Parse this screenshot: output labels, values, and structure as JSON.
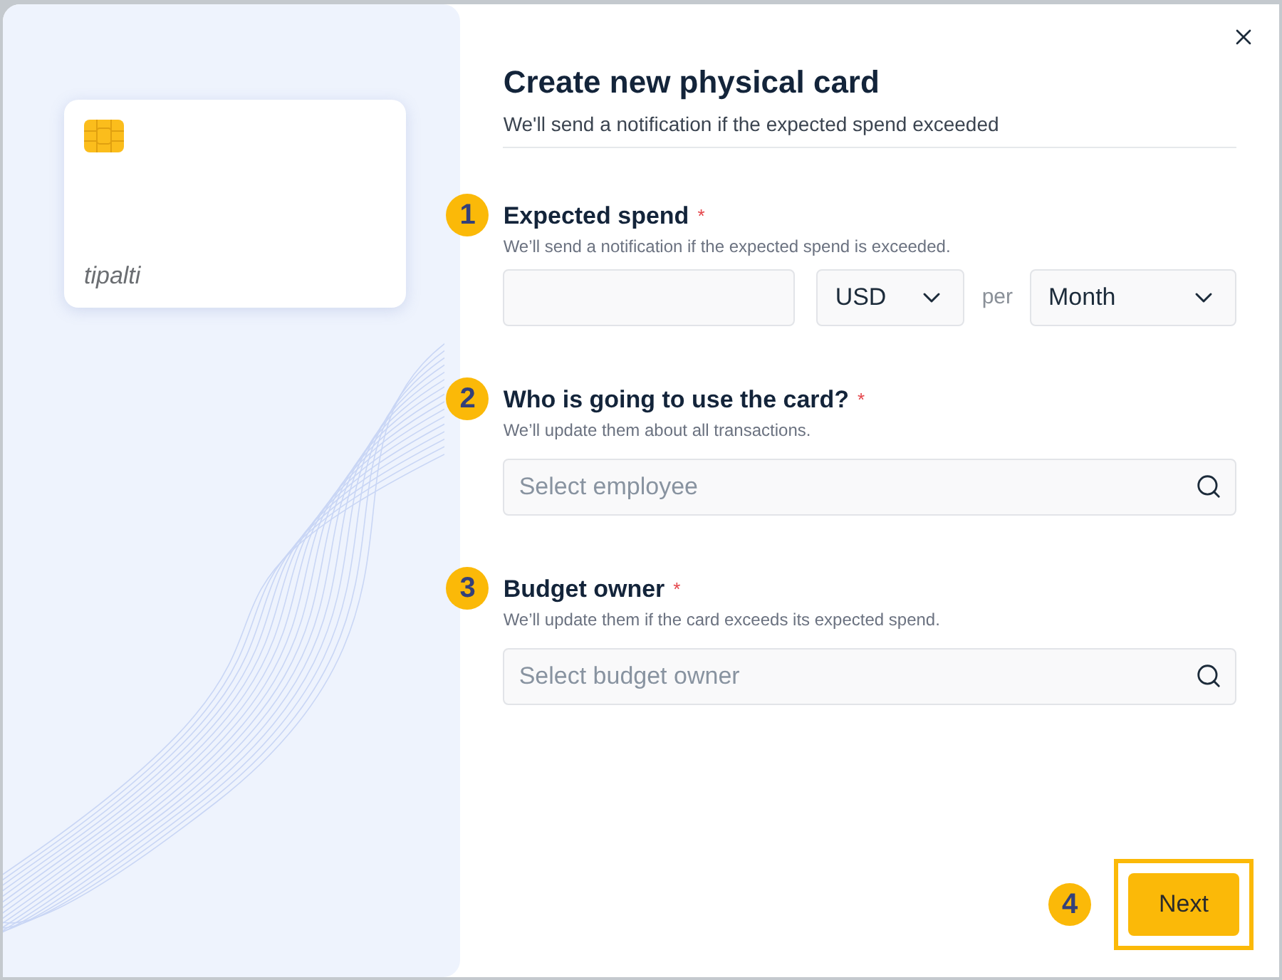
{
  "card_preview": {
    "logo": "tipalti"
  },
  "dialog": {
    "title": "Create new physical card",
    "subtitle": "We'll send a notification if the expected spend exceeded"
  },
  "steps": [
    {
      "number": "1",
      "label": "Expected spend",
      "required_mark": "*",
      "hint": "We’ll send a notification if the expected spend is exceeded.",
      "kind": "amount",
      "currency": "USD",
      "per": "per",
      "period": "Month"
    },
    {
      "number": "2",
      "label": "Who is going to use the card?",
      "required_mark": "*",
      "hint": "We’ll update them about all transactions.",
      "kind": "search",
      "placeholder": "Select employee"
    },
    {
      "number": "3",
      "label": "Budget owner",
      "required_mark": "*",
      "hint": "We’ll update them if the card exceeds its expected spend.",
      "kind": "search",
      "placeholder": "Select budget owner"
    }
  ],
  "next": {
    "number": "4",
    "label": "Next",
    "highlighted": true
  }
}
